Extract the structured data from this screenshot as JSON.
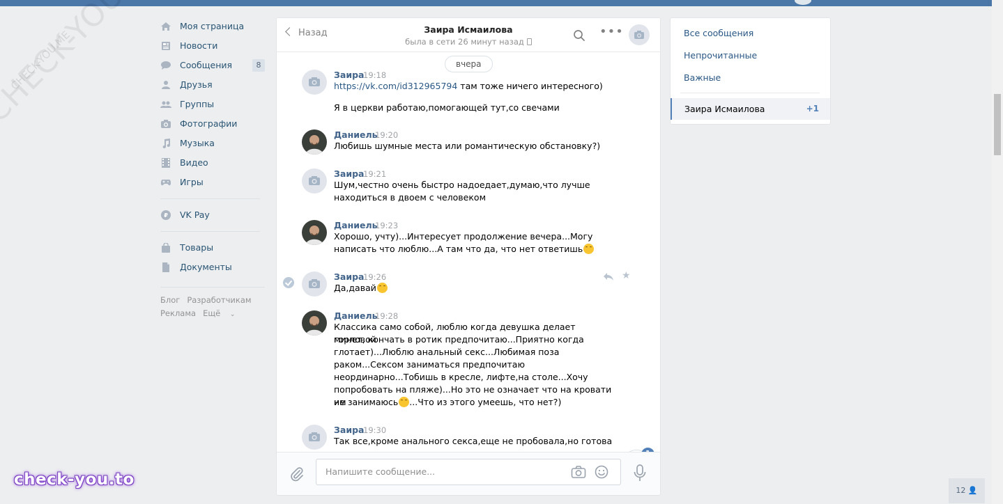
{
  "watermark": {
    "large": "CHECK-YOU.ME",
    "small": "CHECK-YOU.ME",
    "brand": "check-you.to"
  },
  "nav": {
    "items": [
      {
        "label": "Моя страница",
        "icon": "home-icon"
      },
      {
        "label": "Новости",
        "icon": "news-icon"
      },
      {
        "label": "Сообщения",
        "icon": "messages-icon",
        "badge": "8"
      },
      {
        "label": "Друзья",
        "icon": "friends-icon"
      },
      {
        "label": "Группы",
        "icon": "groups-icon"
      },
      {
        "label": "Фотографии",
        "icon": "camera-icon"
      },
      {
        "label": "Музыка",
        "icon": "music-icon"
      },
      {
        "label": "Видео",
        "icon": "video-icon"
      },
      {
        "label": "Игры",
        "icon": "gamepad-icon"
      }
    ],
    "vkpay": "VK Pay",
    "goods": "Товары",
    "docs": "Документы",
    "footer": {
      "blog": "Блог",
      "devs": "Разработчикам",
      "ads": "Реклама",
      "more": "Ещё"
    }
  },
  "chat": {
    "back": "Назад",
    "peer_name": "Заира Исмаилова",
    "peer_status": "была в сети 26 минут назад",
    "date_divider": "вчера",
    "messages": [
      {
        "author": "Заира",
        "time": "19:18",
        "link": "https://vk.com/id312965794",
        "text": " там тоже ничего интересного)",
        "text2": "Я в церкви работаю,помогающей тут,со свечами"
      },
      {
        "author": "Даниель",
        "time": "19:20",
        "text": "Любишь шумные места или романтическую обстановку?)"
      },
      {
        "author": "Заира",
        "time": "19:21",
        "text": "Шум,честно очень быстро надоедает,думаю,что лучше",
        "text2": "находиться в двоем с человеком"
      },
      {
        "author": "Даниель",
        "time": "19:23",
        "text": "Хорошо, учту)...Интересует продолжение вечера...Могу",
        "text2": "написать что люблю...А там что да, что нет ответишь"
      },
      {
        "author": "Заира",
        "time": "19:26",
        "text": "Да,давай"
      },
      {
        "author": "Даниель",
        "time": "19:28",
        "lines": [
          "Классика само собой, люблю когда девушка делает горловой",
          "минет, кончать в ротик предпочитаю...Приятно когда",
          "глотает)...Люблю анальный секс...Любимая поза",
          "раком...Сексом заниматься предпочитаю",
          "неординарно...Тобишь в кресле, лифте,на столе...Хочу",
          "попробовать на пляже)...Но это не означает что на кровати им",
          "не занимаюсь",
          "...Что из этого умеешь, что нет?)"
        ]
      },
      {
        "author": "Заира",
        "time": "19:30",
        "text": "Так все,кроме анального секса,еще не пробовала,но готова"
      }
    ],
    "unread": "1",
    "compose_placeholder": "Напишите сообщение..."
  },
  "right": {
    "all": "Все сообщения",
    "unread": "Непрочитанные",
    "important": "Важные",
    "active_name": "Заира Исмаилова",
    "active_count": "+1"
  },
  "online_count": "12"
}
